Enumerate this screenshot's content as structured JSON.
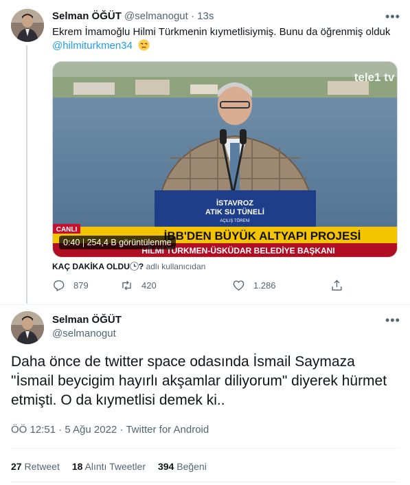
{
  "tweet1": {
    "author_name": "Selman ÖĞÜT",
    "handle": "@selmanogut",
    "separator": "·",
    "time": "13s",
    "text": "Ekrem İmamoğlu Hilmi Türkmenin kıymetlisiymiş. Bunu da öğrenmiş olduk",
    "mention": "@hilmiturkmen34",
    "emoji": "unamused-face",
    "media": {
      "channel_logo": "tele1 tv",
      "podium_line1": "İSTAVROZ",
      "podium_line2": "ATIK SU TÜNELİ",
      "podium_line3": "AÇILIŞ TÖRENİ",
      "banner_live": "CANLI",
      "banner_title": "İBB'DEN BÜYÜK ALTYAPI PROJESİ",
      "banner_subtitle": "HİLMİ TÜRKMEN-ÜSKÜDAR BELEDİYE BAŞKANI",
      "duration": "0:40",
      "views_sep": "|",
      "views": "254,4 B görüntülenme"
    },
    "caption_source": "KAÇ DAKİKA OLDU",
    "caption_question": "?",
    "caption_suffix": "adlı kullanıcıdan",
    "reply_count": "879",
    "retweet_count": "420",
    "like_count": "1.286"
  },
  "tweet2": {
    "author_name": "Selman ÖĞÜT",
    "handle": "@selmanogut",
    "text": "Daha önce de twitter space odasında İsmail Saymaza \"İsmail beycigim hayırlı akşamlar diliyorum\" diyerek hürmet etmişti. O da kıymetlisi demek ki..",
    "meta": "ÖÖ 12:51 · 5 Ağu 2022 · Twitter for Android",
    "retweets_count": "27",
    "retweets_label": "Retweet",
    "quotes_count": "18",
    "quotes_label": "Alıntı Tweetler",
    "likes_count": "394",
    "likes_label": "Beğeni"
  },
  "colors": {
    "text": "#0f1419",
    "muted": "#536471",
    "link": "#1d9bf0",
    "divider": "#eff3f4",
    "banner_yellow": "#f5c400",
    "banner_red": "#c8102e"
  }
}
